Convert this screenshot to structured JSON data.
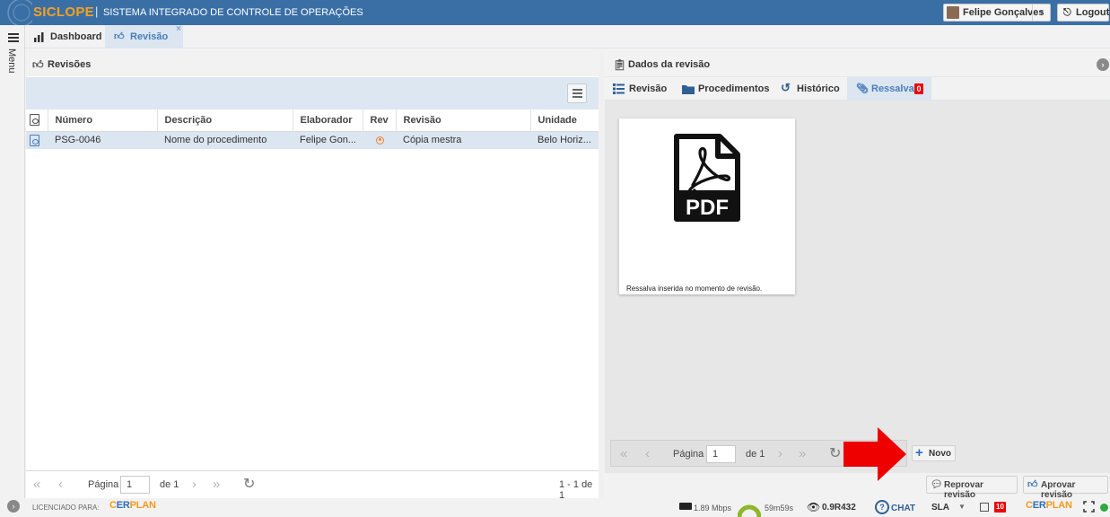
{
  "app": {
    "brand": "SICLOPE",
    "separator": "|",
    "subtitle": "SISTEMA INTEGRADO DE CONTROLE DE OPERAÇÕES",
    "user_name": "Felipe Gonçalves",
    "logout_label": "Logout",
    "menu_label": "Menu"
  },
  "tabs": [
    {
      "label": "Dashboard",
      "icon": "bar-chart-icon"
    },
    {
      "label": "Revisão",
      "icon": "thumbs-up-icon",
      "close": "×"
    }
  ],
  "left_panel": {
    "title": "Revisões",
    "columns": [
      "Número",
      "Descrição",
      "Elaborador",
      "Rev",
      "Revisão",
      "Unidade"
    ],
    "rows": [
      {
        "numero": "PSG-0046",
        "descricao": "Nome do procedimento",
        "elaborador": "Felipe Gon...",
        "rev_icon": "target-icon",
        "revisao": "Cópia mestra",
        "unidade": "Belo Horiz..."
      }
    ],
    "pager": {
      "page_label": "Página",
      "page": "1",
      "of_label": "de 1",
      "summary": "1 - 1 de 1"
    }
  },
  "right_panel": {
    "title": "Dados da revisão",
    "tabs": [
      {
        "label": "Revisão",
        "icon": "list-icon"
      },
      {
        "label": "Procedimentos",
        "icon": "folder-icon"
      },
      {
        "label": "Histórico",
        "icon": "history-icon"
      },
      {
        "label": "Ressalva",
        "icon": "paperclip-icon",
        "badge": "0"
      }
    ],
    "attachment": {
      "file_badge": "PDF",
      "caption": "Ressalva inserida no momento de revisão."
    },
    "pager": {
      "page_label": "Página",
      "page": "1",
      "of_label": "de 1"
    },
    "new_button": "Novo",
    "reject_button": "Reprovar revisão",
    "approve_button": "Aprovar revisão"
  },
  "footer": {
    "licensed_label": "LICENCIADO PARA:",
    "erplan_a": "ER",
    "erplan_b": "PLAN",
    "network": "1.89 Mbps",
    "uptime": "59m59s",
    "version": "0.9R432",
    "chat_label": "CHAT",
    "chat_glyph": "?",
    "sla_label": "SLA",
    "notifications": "10"
  },
  "colors": {
    "header_bg": "#3a6fa6",
    "brand": "#f7a21b",
    "active_tab_bg": "#dbe6f1",
    "accent": "#4a7db8",
    "badge_red": "#ee0000",
    "status_green": "#2eaa3e",
    "annotation_arrow": "#ee0000"
  }
}
